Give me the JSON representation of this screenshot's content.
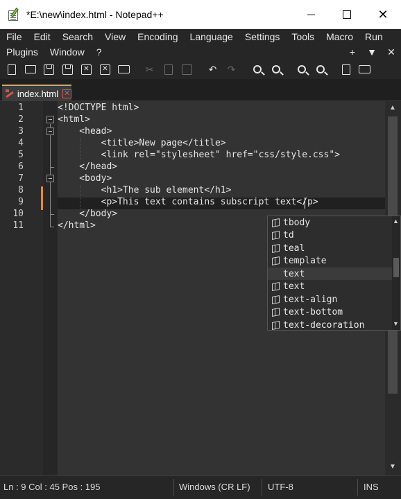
{
  "window": {
    "title": "*E:\\new\\index.html - Notepad++"
  },
  "menu": {
    "row1": [
      "File",
      "Edit",
      "Search",
      "View",
      "Encoding",
      "Language",
      "Settings",
      "Tools",
      "Macro",
      "Run"
    ],
    "row2": [
      "Plugins",
      "Window",
      "?"
    ],
    "right": [
      "+",
      "▼",
      "✕"
    ]
  },
  "tab": {
    "label": "index.html",
    "close": "✕"
  },
  "editor": {
    "line_numbers": [
      "1",
      "2",
      "3",
      "4",
      "5",
      "6",
      "7",
      "8",
      "9",
      "10",
      "11"
    ],
    "lines": [
      "<!DOCTYPE html>",
      "<html>",
      "    <head>",
      "        <title>New page</title>",
      "        <link rel=\"stylesheet\" href=\"css/style.css\">",
      "    </head>",
      "    <body>",
      "        <h1>The sub element</h1>",
      "        <p>This text contains subscript text</p>",
      "    </body>",
      "</html>"
    ]
  },
  "autocomplete": {
    "items": [
      "tbody",
      "td",
      "teal",
      "template",
      "text",
      "text",
      "text-align",
      "text-bottom",
      "text-decoration"
    ],
    "selected_index": 4
  },
  "status": {
    "position": "Ln : 9    Col : 45    Pos : 195",
    "eol": "Windows (CR LF)",
    "encoding": "UTF-8",
    "mode": "INS"
  }
}
